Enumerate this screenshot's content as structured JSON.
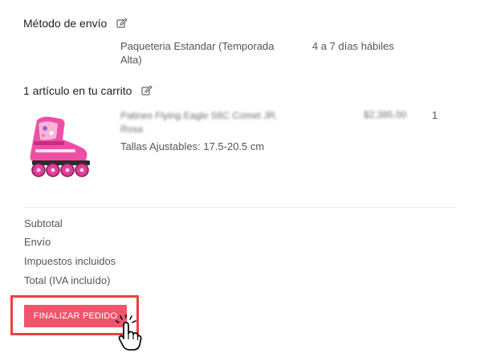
{
  "shipping": {
    "heading": "Método de envío",
    "method_line1": "Paqueteria Estandar (Temporada",
    "method_line2": "Alta)",
    "delivery_time": "4 a 7 días hábiles"
  },
  "cart": {
    "heading": "1 artículo en tu carrito",
    "item": {
      "name_line1": "Patines Flying Eagle S6C Comet JR.",
      "name_line2": "Rosa",
      "price": "$2,385.00",
      "quantity": "1",
      "variant": "Tallas Ajustables: 17.5-20.5 cm",
      "image_icon": "pink-inline-skate"
    }
  },
  "summary": {
    "subtotal_label": "Subtotal",
    "shipping_label": "Envío",
    "taxes_label": "Impuestos incluidos",
    "total_label": "Total (IVA incluído)"
  },
  "checkout": {
    "button_label": "FINALIZAR PEDIDO",
    "button_color": "#f0556b",
    "highlight_color": "#e8423f",
    "cursor_icon": "hand-pointer-click"
  }
}
